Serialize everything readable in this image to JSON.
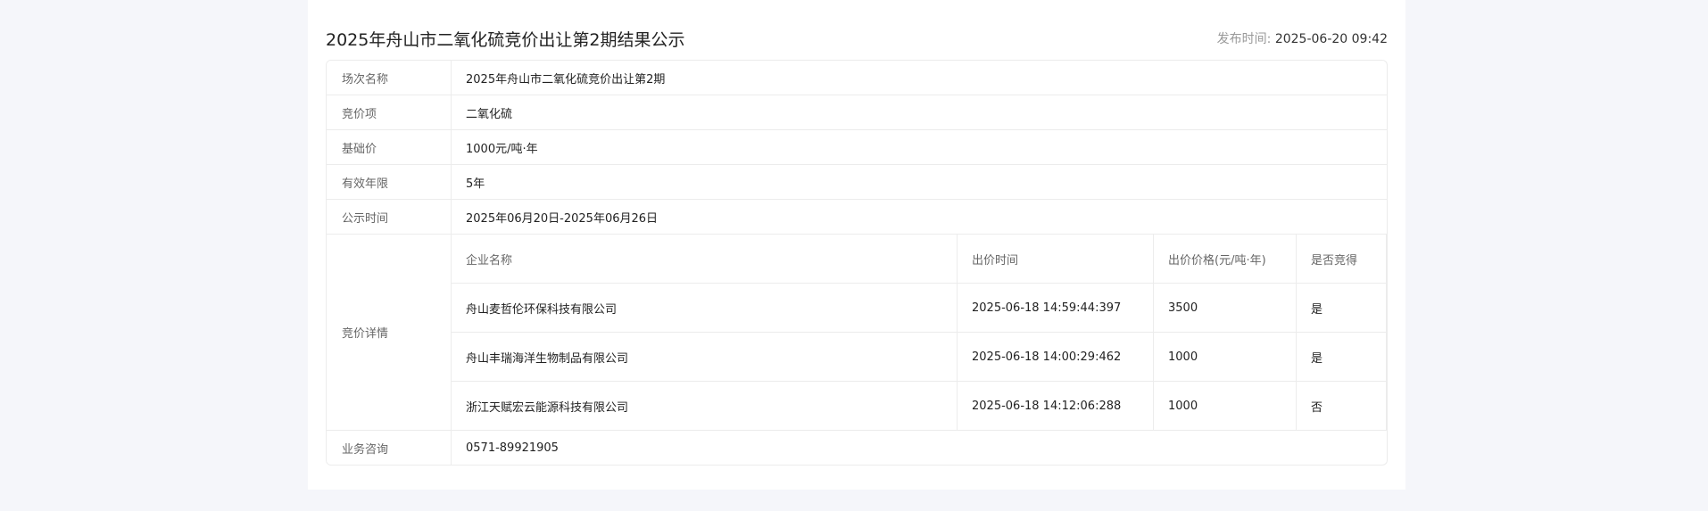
{
  "header": {
    "title": "2025年舟山市二氧化硫竞价出让第2期结果公示",
    "publish_label": "发布时间:",
    "publish_time": "2025-06-20 09:42"
  },
  "info": {
    "session_label": "场次名称",
    "session_value": "2025年舟山市二氧化硫竞价出让第2期",
    "item_label": "竞价项",
    "item_value": "二氧化硫",
    "base_price_label": "基础价",
    "base_price_value": "1000元/吨·年",
    "valid_years_label": "有效年限",
    "valid_years_value": "5年",
    "notice_period_label": "公示时间",
    "notice_period_value": "2025年06月20日-2025年06月26日",
    "bid_details_label": "竞价详情",
    "consult_label": "业务咨询",
    "consult_value": "0571-89921905"
  },
  "bids": {
    "headers": [
      "企业名称",
      "出价时间",
      "出价价格(元/吨·年)",
      "是否竞得"
    ],
    "rows": [
      {
        "company": "舟山麦哲伦环保科技有限公司",
        "time": "2025-06-18 14:59:44:397",
        "price": "3500",
        "won": "是"
      },
      {
        "company": "舟山丰瑞海洋生物制品有限公司",
        "time": "2025-06-18 14:00:29:462",
        "price": "1000",
        "won": "是"
      },
      {
        "company": "浙江天赋宏云能源科技有限公司",
        "time": "2025-06-18 14:12:06:288",
        "price": "1000",
        "won": "否"
      }
    ]
  }
}
